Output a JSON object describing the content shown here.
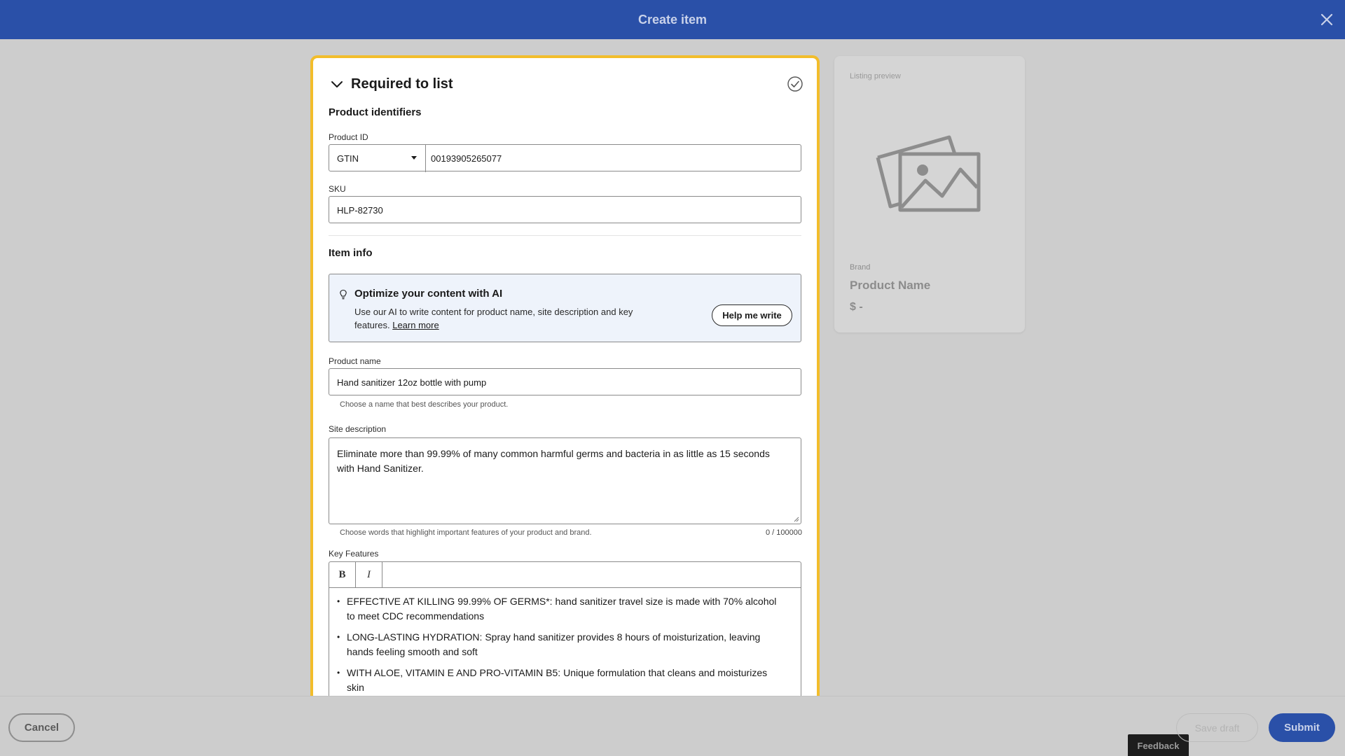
{
  "header": {
    "title": "Create item",
    "close_icon": "close-icon"
  },
  "section": {
    "title": "Required to list",
    "toggle_icon": "chevron-down-icon",
    "status_icon": "check-circle-icon"
  },
  "product_identifiers": {
    "heading": "Product identifiers",
    "product_id_label": "Product ID",
    "id_type": "GTIN",
    "id_value": "00193905265077",
    "sku_label": "SKU",
    "sku_value": "HLP-82730"
  },
  "item_info": {
    "heading": "Item info",
    "ai": {
      "icon": "lightbulb-icon",
      "title": "Optimize your content with AI",
      "description": "Use our AI to write content for product name, site description and key features.",
      "learn_more": "Learn more",
      "button": "Help me write"
    },
    "product_name_label": "Product name",
    "product_name_value": "Hand sanitizer 12oz bottle with pump",
    "product_name_hint": "Choose a name that best describes your product.",
    "site_description_label": "Site description",
    "site_description_value": "Eliminate more than 99.99% of many common harmful germs and bacteria in as little as 15 seconds with Hand Sanitizer.",
    "site_description_hint": "Choose words that highlight important features of your product and brand.",
    "site_description_counter": "0 / 100000",
    "key_features_label": "Key Features",
    "bold_button": "B",
    "italic_button": "I",
    "key_features": [
      "EFFECTIVE AT KILLING 99.99% OF GERMS*: hand sanitizer travel size is made with 70% alcohol to meet CDC recommendations",
      "LONG-LASTING HYDRATION: Spray hand sanitizer provides 8 hours of moisturization, leaving hands feeling smooth and soft",
      "WITH ALOE, VITAMIN E AND PRO-VITAMIN B5: Unique formulation that cleans and moisturizes skin"
    ]
  },
  "preview": {
    "label": "Listing preview",
    "image_icon": "image-placeholder-icon",
    "brand": "Brand",
    "product_name": "Product Name",
    "price": "$ -"
  },
  "footer": {
    "cancel": "Cancel",
    "save_draft": "Save draft",
    "submit": "Submit",
    "feedback": "Feedback"
  },
  "colors": {
    "header_blue": "#2a50a8",
    "focus_outline": "#f2bd2b",
    "ai_box_bg": "#eef3fb"
  }
}
